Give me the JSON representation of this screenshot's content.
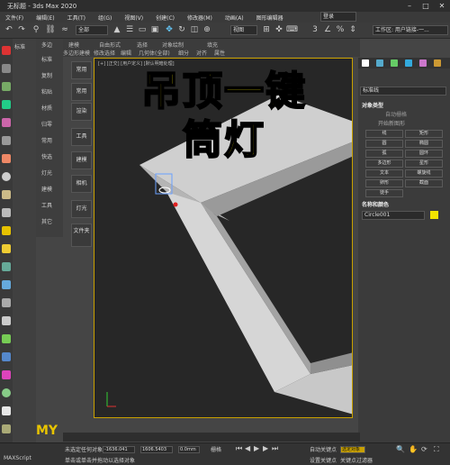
{
  "window": {
    "title": "无标题 - 3ds Max 2020"
  },
  "menu": [
    "文件(F)",
    "编辑(E)",
    "工具(T)",
    "组(G)",
    "视图(V)",
    "创建(C)",
    "修改器(M)",
    "动画(A)",
    "图形编辑器"
  ],
  "toolbar": {
    "filter": "全部",
    "view": "视图",
    "login": "登录",
    "workspace": "工作区: 用户链接-一..."
  },
  "ribbon": {
    "row1": [
      "建模",
      "自由形式",
      "选择",
      "对象绘制",
      "填充"
    ],
    "row2": [
      "多边形建模",
      "修改选择",
      "编辑",
      "几何体(全部)",
      "细分",
      "对齐",
      "属性"
    ]
  },
  "side_tabs": [
    "标准",
    "复制",
    "粘贴",
    "材质",
    "归零",
    "常用",
    "快选",
    "灯光",
    "建模",
    "工具",
    "其它"
  ],
  "left_panel": [
    "多边",
    "建模"
  ],
  "cmd_buttons": [
    "常用",
    "渲染",
    "工具",
    "建模",
    "相机",
    "灯光",
    "文件夹"
  ],
  "viewport": {
    "label": "[+] [正交] [用户定义] [默认明暗处理]",
    "overlay_line1": "吊顶一键",
    "overlay_line2": "筒灯"
  },
  "right_panel": {
    "dropdown": "标准线",
    "section1": "对象类型",
    "auto_grid": "自动栅格",
    "start_new": "开始新图形",
    "buttons": [
      "线",
      "矩形",
      "圆",
      "椭圆",
      "弧",
      "圆环",
      "多边形",
      "星形",
      "文本",
      "螺旋线",
      "卵形",
      "截面",
      "徒手"
    ],
    "section2": "名称和颜色",
    "name_value": "Circle001"
  },
  "status": {
    "sel": "未选定任何对象",
    "hint": "单击或单击并拖动以选择对象",
    "x": "-1636.041",
    "y": "1606.5403",
    "z": "0.0mm",
    "grid": "栅格",
    "autokey": "自动关键点",
    "setkey": "设置关键点",
    "filter": "选定对象",
    "key_filter": "关键点过滤器",
    "maxscript": "MAXScript"
  },
  "colors": {
    "accent": "#f3e300",
    "frame": "#c8a000"
  }
}
